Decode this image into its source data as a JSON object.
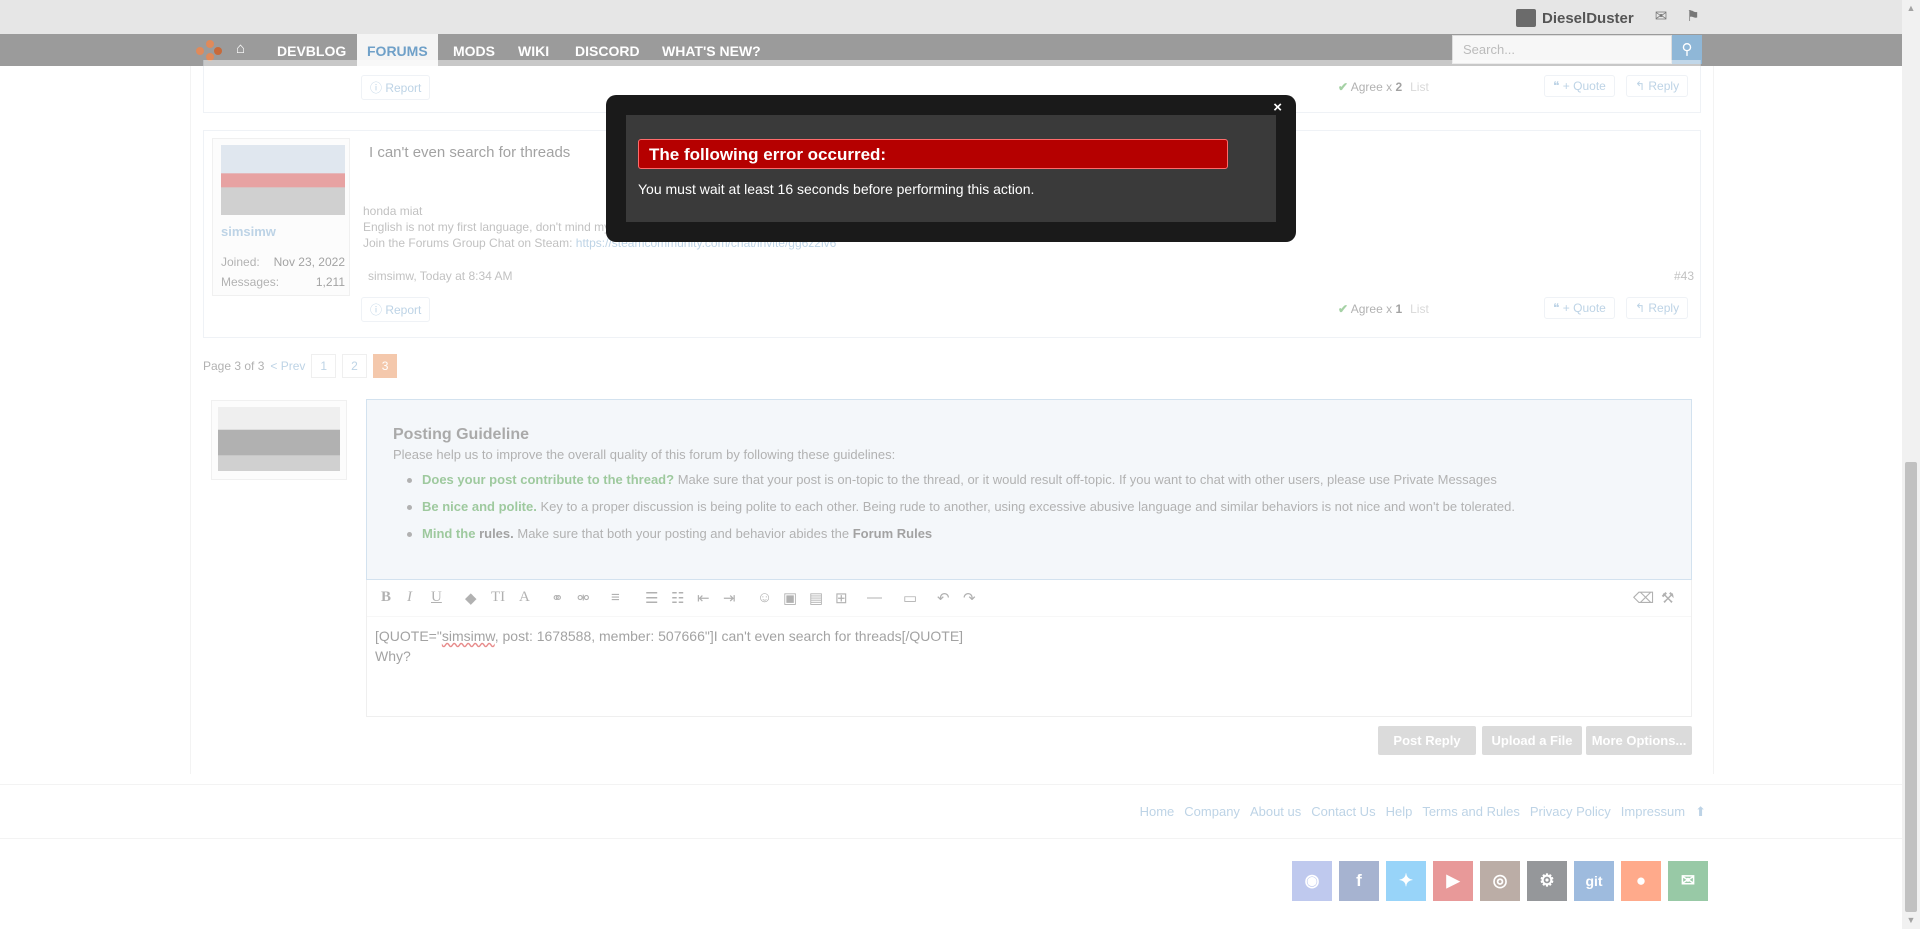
{
  "topbar": {
    "username": "DieselDuster"
  },
  "nav": {
    "items": [
      "DEVBLOG",
      "FORUMS",
      "MODS",
      "WIKI",
      "DISCORD",
      "WHAT'S NEW?"
    ],
    "search_placeholder": "Search..."
  },
  "post_prev": {
    "report_label": "Report",
    "agree_prefix": "Agree x",
    "agree_count": "2",
    "list_label": "List",
    "quote_label": "+ Quote",
    "reply_label": "Reply"
  },
  "post_43": {
    "title": "I can't even search for threads",
    "signature": [
      "honda miat",
      "English is not my first language, don't mind my poor grammar or spelling",
      "Join the Forums Group Chat on Steam: "
    ],
    "signature_link": "https://steamcommunity.com/chat/invite/gg6z2lv6",
    "username": "simsimw",
    "joined_label": "Joined:",
    "joined_value": "Nov 23, 2022",
    "messages_label": "Messages:",
    "messages_value": "1,211",
    "meta": "simsimw, Today at 8:34 AM",
    "post_number": "#43",
    "report_label": "Report",
    "agree_prefix": "Agree x",
    "agree_count": "1",
    "list_label": "List",
    "quote_label": "+ Quote",
    "reply_label": "Reply"
  },
  "pagination": {
    "label": "Page 3 of 3",
    "prev": "< Prev",
    "pages": [
      "1",
      "2",
      "3"
    ],
    "current": "3"
  },
  "guideline": {
    "title": "Posting Guideline",
    "intro": "Please help us to improve the overall quality of this forum by following these guidelines:",
    "b1_bold": "Does your post contribute to the thread?",
    "b1_text": " Make sure that your post is on-topic to the thread, or it would result off-topic. If you want to chat with other users, please use Private Messages",
    "b2_bold": "Be nice and polite.",
    "b2_text": " Key to a proper discussion is being polite to each other. Being rude to another, using excessive abusive language and similar behaviors is not nice and won't be tolerated.",
    "b3_bold": "Mind the",
    "b3_rules": "rules.",
    "b3_text": " Make sure that both your posting and behavior abides the ",
    "b3_link": "Forum Rules"
  },
  "editor": {
    "line1_pre": "[QUOTE=\"",
    "line1_misspelled": "simsimw",
    "line1_post": ", post: 1678588, member: 507666\"]I can't even search for threads[/QUOTE]",
    "line2": "Why?",
    "buttons": [
      "Post Reply",
      "Upload a File",
      "More Options..."
    ]
  },
  "footer": {
    "links": [
      "Home",
      "Company",
      "About us",
      "Contact Us",
      "Help",
      "Terms and Rules",
      "Privacy Policy",
      "Impressum"
    ],
    "social": [
      {
        "name": "discord-icon",
        "glyph": "◉",
        "color": "#7289da"
      },
      {
        "name": "facebook-icon",
        "glyph": "f",
        "color": "#3b5998"
      },
      {
        "name": "twitter-icon",
        "glyph": "✦",
        "color": "#1da1f2"
      },
      {
        "name": "youtube-icon",
        "glyph": "▶",
        "color": "#cd201f"
      },
      {
        "name": "instagram-icon",
        "glyph": "◎",
        "color": "#6b4c3b"
      },
      {
        "name": "steam-icon",
        "glyph": "⚙",
        "color": "#171a21"
      },
      {
        "name": "git-icon",
        "glyph": "git",
        "color": "#2b6ab8"
      },
      {
        "name": "reddit-icon",
        "glyph": "●",
        "color": "#ff4500"
      },
      {
        "name": "email-icon",
        "glyph": "✉",
        "color": "#1c8a3c"
      }
    ]
  },
  "modal": {
    "title": "The following error occurred:",
    "message": "You must wait at least 16 seconds before performing this action.",
    "close": "×"
  }
}
